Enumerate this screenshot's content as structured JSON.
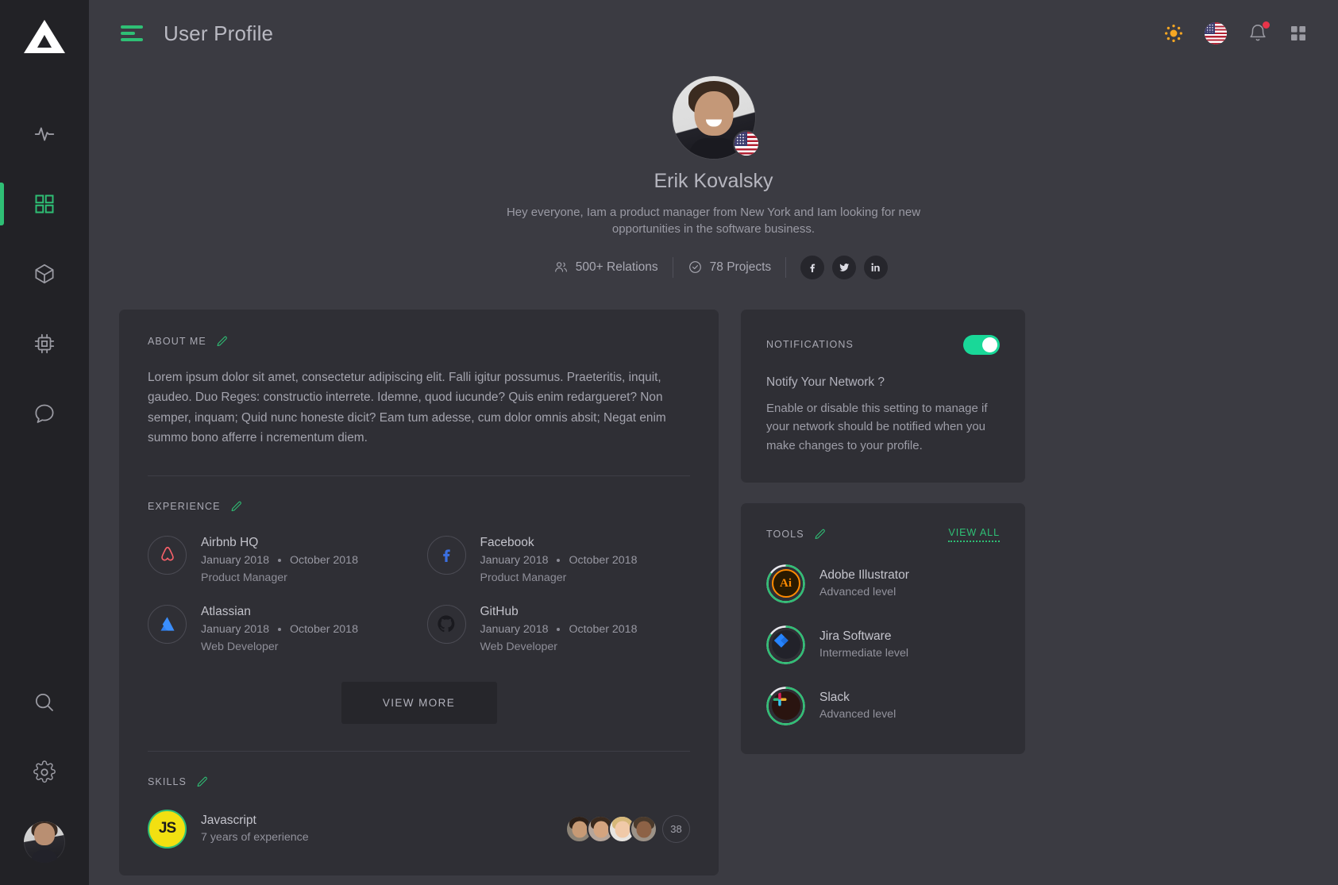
{
  "brand": {
    "logo_icon": "triangle-logo"
  },
  "sidebar": {
    "items": [
      {
        "name": "activity",
        "icon": "activity-pulse-icon",
        "active": false
      },
      {
        "name": "dashboard",
        "icon": "grid-icon",
        "active": true
      },
      {
        "name": "packages",
        "icon": "cube-icon",
        "active": false
      },
      {
        "name": "hardware",
        "icon": "cpu-chip-icon",
        "active": false
      },
      {
        "name": "messages",
        "icon": "chat-bubble-icon",
        "active": false
      }
    ],
    "bottom_items": [
      {
        "name": "search",
        "icon": "search-icon"
      },
      {
        "name": "settings",
        "icon": "gear-icon"
      },
      {
        "name": "account",
        "icon": "user-avatar"
      }
    ]
  },
  "header": {
    "menu_icon": "hamburger-menu-icon",
    "title": "User Profile",
    "actions": [
      {
        "name": "theme",
        "icon": "sun-icon"
      },
      {
        "name": "language",
        "icon": "usa-flag-icon"
      },
      {
        "name": "notifications",
        "icon": "bell-icon",
        "has_badge": true
      },
      {
        "name": "apps",
        "icon": "grid-apps-icon"
      }
    ]
  },
  "profile": {
    "avatar_icon": "user-avatar-large",
    "country_flag": "usa-flag-icon",
    "name": "Erik Kovalsky",
    "bio": "Hey everyone,  Iam a product manager from New York and Iam looking for new opportunities in the software business.",
    "stats": [
      {
        "icon": "people-icon",
        "label": "500+ Relations"
      },
      {
        "icon": "check-circle-icon",
        "label": "78 Projects"
      }
    ],
    "socials": [
      {
        "name": "facebook",
        "icon": "facebook-icon"
      },
      {
        "name": "twitter",
        "icon": "twitter-icon"
      },
      {
        "name": "linkedin",
        "icon": "linkedin-icon"
      }
    ]
  },
  "about": {
    "title": "ABOUT ME",
    "edit_icon": "pencil-icon",
    "text": "Lorem ipsum dolor sit amet, consectetur adipiscing elit. Falli igitur possumus. Praeteritis, inquit, gaudeo. Duo Reges: constructio interrete. Idemne, quod iucunde? Quis enim redargueret? Non semper, inquam; Quid nunc honeste dicit? Eam tum adesse, cum dolor omnis absit; Negat enim summo bono afferre i ncrementum diem."
  },
  "experience": {
    "title": "EXPERIENCE",
    "edit_icon": "pencil-icon",
    "items": [
      {
        "company": "Airbnb HQ",
        "logo": "airbnb-icon",
        "start": "January 2018",
        "end": "October 2018",
        "role": "Product Manager"
      },
      {
        "company": "Facebook",
        "logo": "facebook-icon",
        "start": "January 2018",
        "end": "October 2018",
        "role": "Product Manager"
      },
      {
        "company": "Atlassian",
        "logo": "atlassian-icon",
        "start": "January 2018",
        "end": "October 2018",
        "role": "Web Developer"
      },
      {
        "company": "GitHub",
        "logo": "github-icon",
        "start": "January 2018",
        "end": "October 2018",
        "role": "Web Developer"
      }
    ],
    "view_more_label": "VIEW MORE"
  },
  "skills": {
    "title": "SKILLS",
    "edit_icon": "pencil-icon",
    "items": [
      {
        "name": "Javascript",
        "badge": "JS",
        "experience": "7 years of experience",
        "extra_count": "38"
      }
    ]
  },
  "notifications": {
    "title": "NOTIFICATIONS",
    "toggle_on": true,
    "question": "Notify Your Network ?",
    "description": "Enable or disable this setting to manage if your network should be notified when you make changes to your profile."
  },
  "tools": {
    "title": "TOOLS",
    "edit_icon": "pencil-icon",
    "view_all_label": "VIEW ALL",
    "items": [
      {
        "name": "Adobe Illustrator",
        "icon": "adobe-illustrator-icon",
        "level": "Advanced level",
        "progress": 85
      },
      {
        "name": "Jira Software",
        "icon": "jira-icon",
        "level": "Intermediate level",
        "progress": 85
      },
      {
        "name": "Slack",
        "icon": "slack-icon",
        "level": "Advanced level",
        "progress": 85
      }
    ]
  },
  "colors": {
    "accent_green": "#2fbf75",
    "toggle_green": "#19d898",
    "background": "#3b3b42",
    "card": "#2f2f35",
    "rail": "#222226",
    "badge_red": "#e8344a",
    "sun_orange": "#f5a623"
  }
}
